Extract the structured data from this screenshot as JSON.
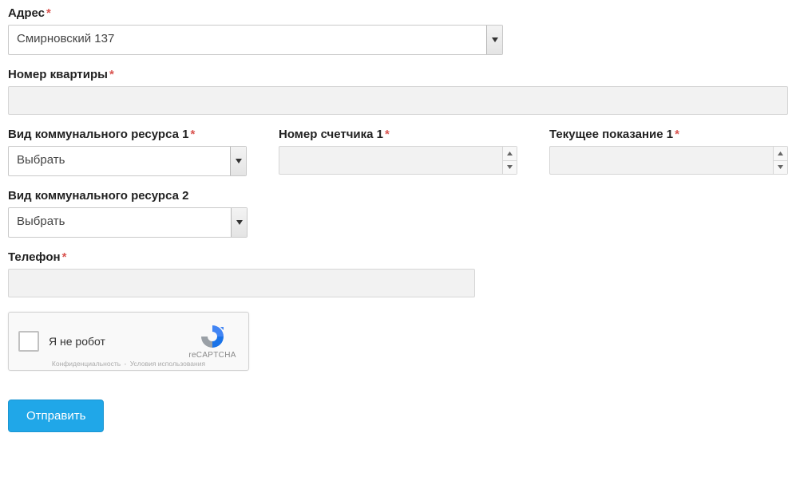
{
  "address": {
    "label": "Адрес",
    "required": true,
    "value": "Смирновский 137"
  },
  "apartment": {
    "label": "Номер квартиры",
    "required": true,
    "value": ""
  },
  "row1": {
    "resource1": {
      "label": "Вид коммунального ресурса 1",
      "required": true,
      "value": "Выбрать"
    },
    "meter1": {
      "label": "Номер счетчика 1",
      "required": true,
      "value": ""
    },
    "reading1": {
      "label": "Текущее показание 1",
      "required": true,
      "value": ""
    }
  },
  "resource2": {
    "label": "Вид коммунального ресурса 2",
    "required": false,
    "value": "Выбрать"
  },
  "phone": {
    "label": "Телефон",
    "required": true,
    "value": ""
  },
  "captcha": {
    "text": "Я не робот",
    "brand": "reCAPTCHA",
    "privacy": "Конфиденциальность",
    "terms": "Условия использования"
  },
  "submit": {
    "label": "Отправить"
  },
  "asterisk": "*"
}
